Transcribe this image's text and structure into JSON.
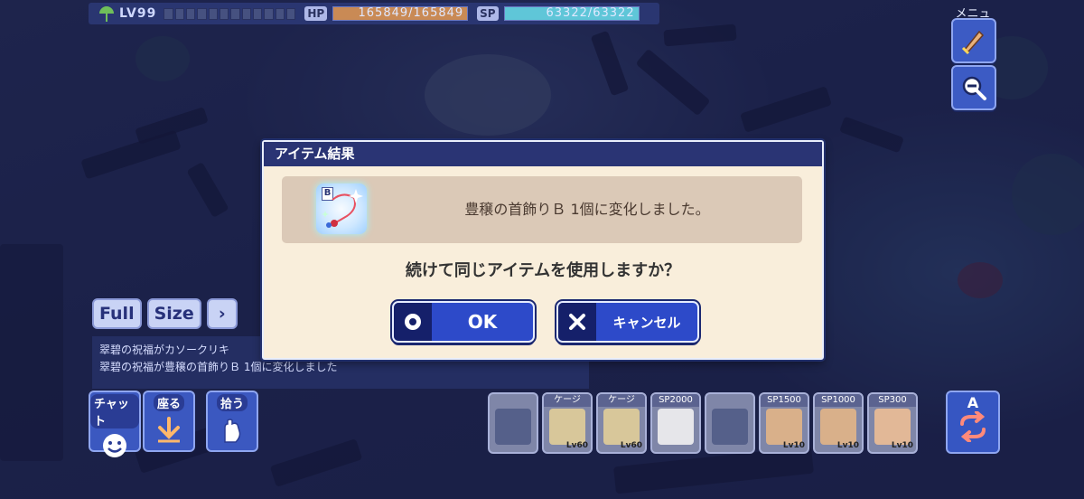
{
  "status": {
    "level": "LV99",
    "hp_tag": "HP",
    "hp": "165849/165849",
    "hp_ratio": 1.0,
    "sp_tag": "SP",
    "sp": "63322/63322",
    "sp_ratio": 1.0
  },
  "menu": {
    "label": "メニュー"
  },
  "chat": {
    "full_label": "Full",
    "size_label": "Size",
    "arrow": "›",
    "log": [
      "翠碧の祝福がカソークリキ",
      "翠碧の祝福が豊穣の首飾りＢ 1個に変化しました"
    ]
  },
  "actions": {
    "chat": "チャット",
    "sit": "座る",
    "pickup": "拾う"
  },
  "slots": [
    {
      "top": "",
      "lvl": ""
    },
    {
      "top": "ケージ",
      "lvl": "Lv60"
    },
    {
      "top": "ケージ",
      "lvl": "Lv60"
    },
    {
      "top": "SP2000",
      "lvl": ""
    },
    {
      "top": "",
      "lvl": ""
    },
    {
      "top": "SP1500",
      "lvl": "Lv10"
    },
    {
      "top": "SP1000",
      "lvl": "Lv10"
    },
    {
      "top": "SP300",
      "lvl": "Lv10"
    }
  ],
  "a_button": {
    "label": "A"
  },
  "dialog": {
    "title": "アイテム結果",
    "item_grade": "B",
    "result_message": "豊穣の首飾りＢ 1個に変化しました。",
    "question": "続けて同じアイテムを使用しますか？",
    "ok_label": "OK",
    "cancel_label": "キャンセル"
  },
  "colors": {
    "hp_fill": "#c98a55",
    "sp_fill": "#5fc6d8",
    "button_blue": "#2d4ac9",
    "dialog_bg": "#f9eedb"
  }
}
